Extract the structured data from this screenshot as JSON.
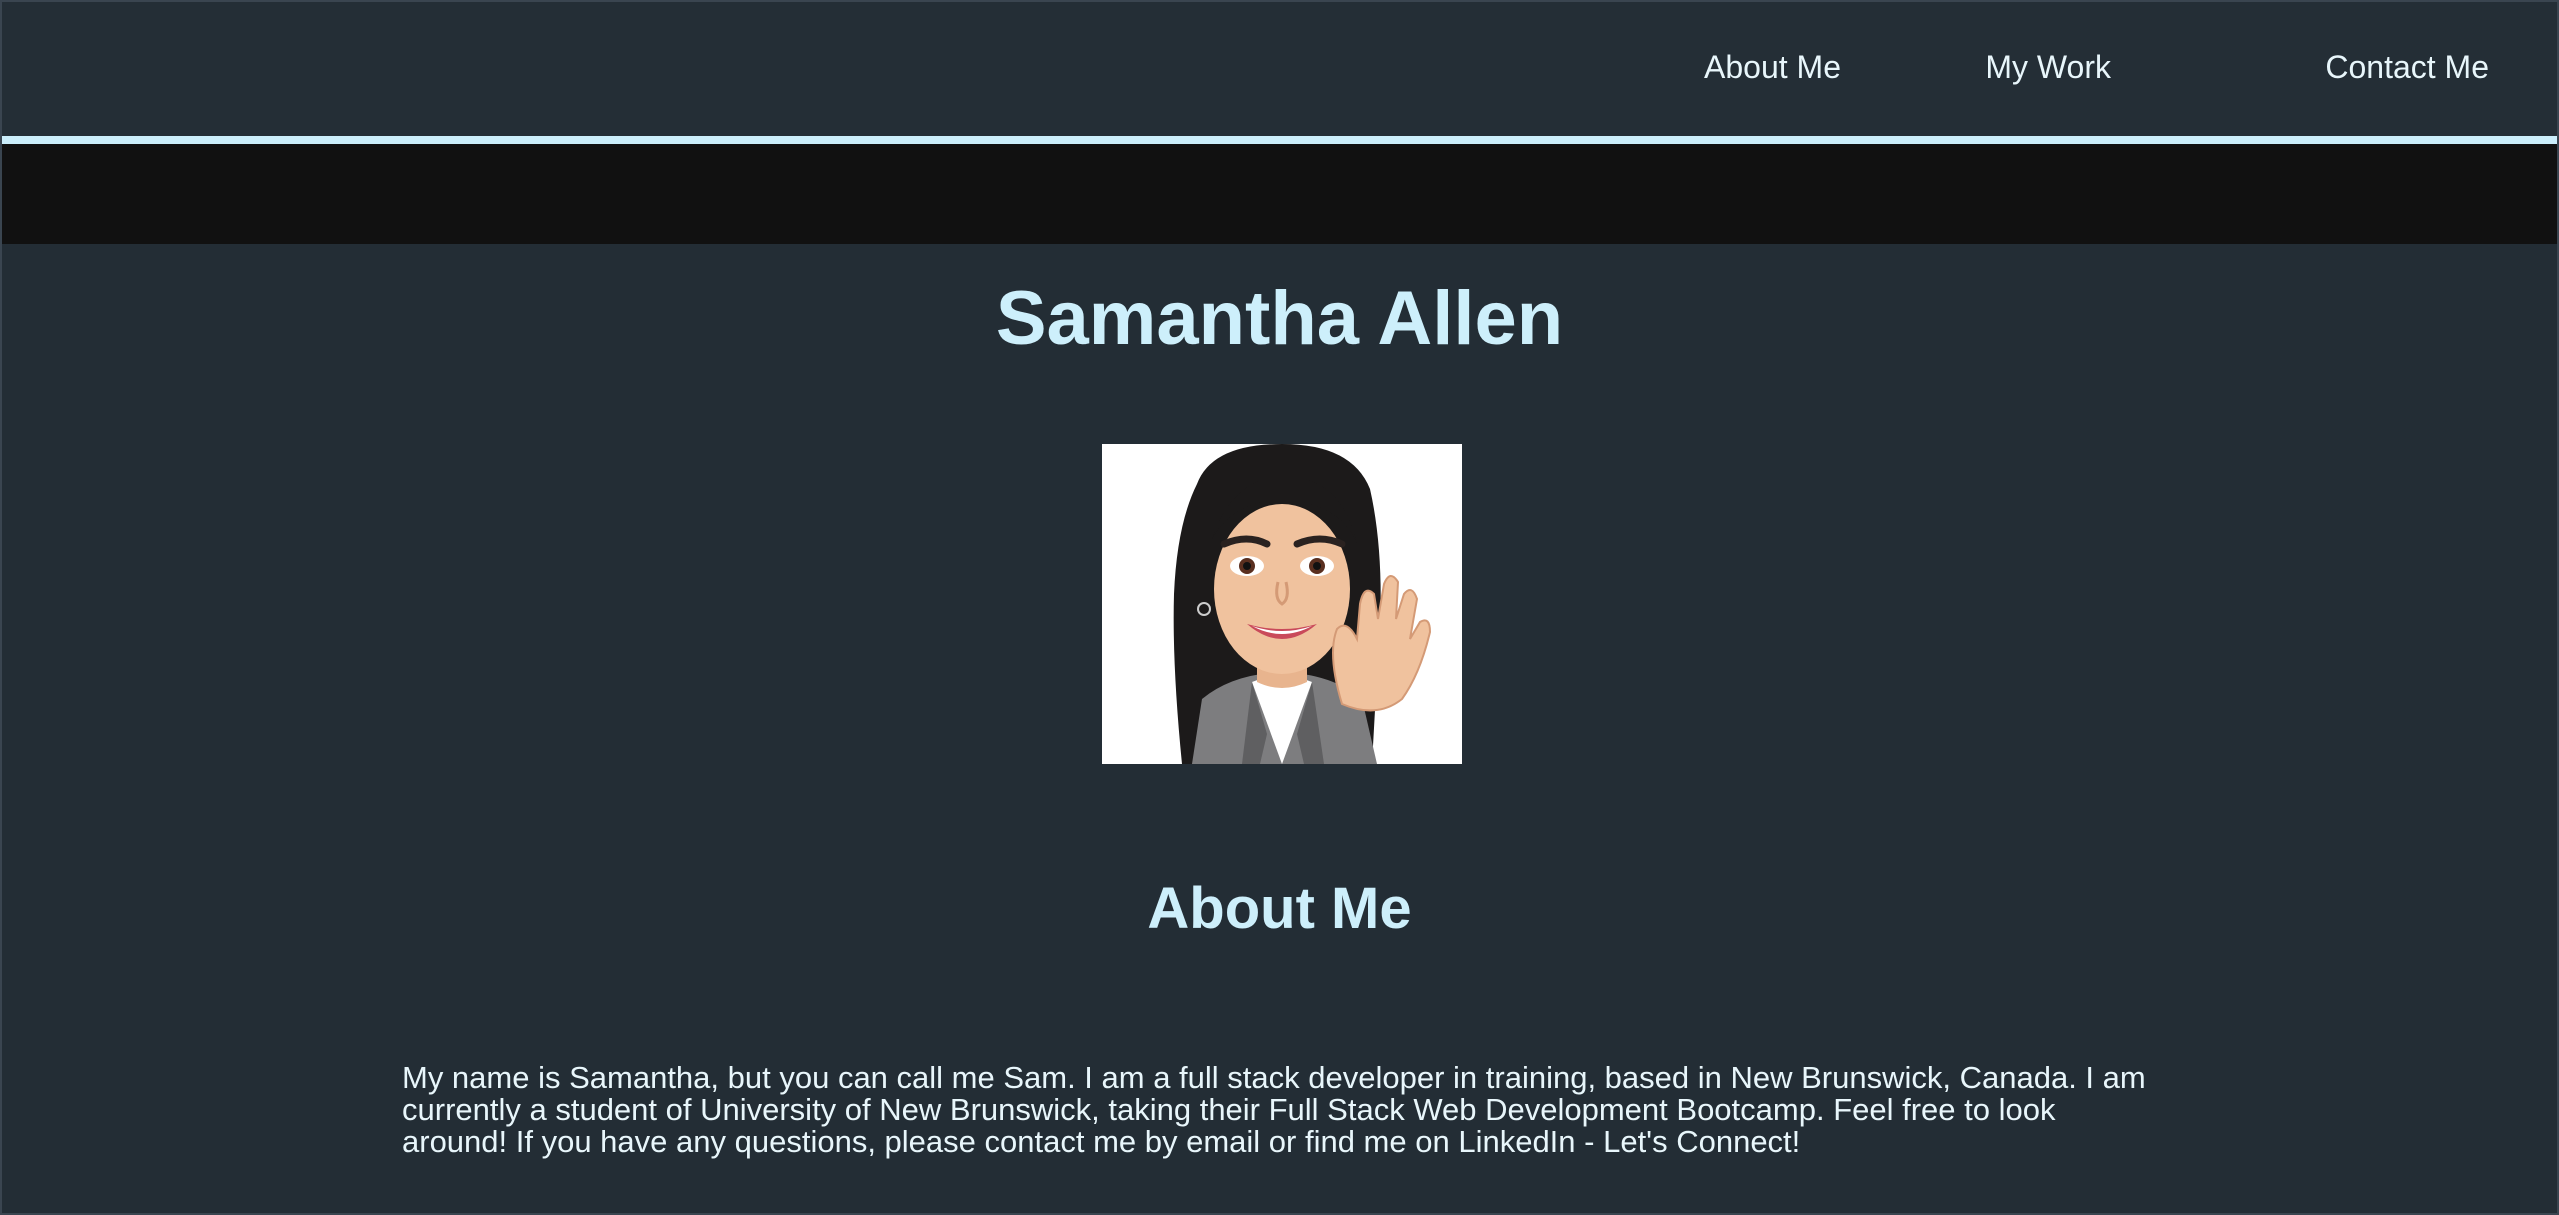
{
  "nav": {
    "links": [
      "About Me",
      "My Work",
      "Contact Me"
    ]
  },
  "header": {
    "name": "Samantha Allen"
  },
  "about": {
    "heading": "About Me",
    "bio": "My name is Samantha, but you can call me Sam. I am a full stack developer in training, based in New Brunswick, Canada. I am currently a student of University of New Brunswick, taking their Full Stack Web Development Bootcamp. Feel free to look around! If you have any questions, please contact me by email or find me on LinkedIn - Let's Connect!"
  },
  "colors": {
    "background": "#232d35",
    "accent": "#cdeffb",
    "band": "#111111"
  },
  "icons": {
    "avatar": "memoji-avatar-waving"
  }
}
